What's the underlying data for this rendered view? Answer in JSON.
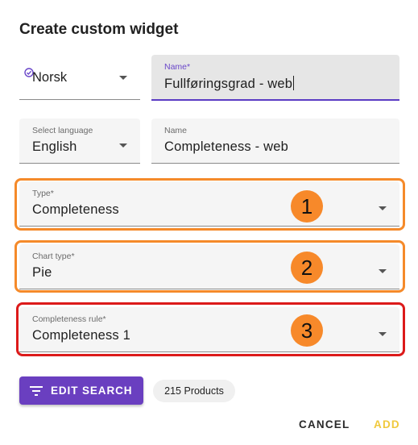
{
  "dialog": {
    "title": "Create custom widget",
    "primary_language": {
      "value": "Norsk"
    },
    "primary_name": {
      "label": "Name",
      "required_mark": "*",
      "value": "Fullføringsgrad - web"
    },
    "language_select": {
      "label": "Select language",
      "value": "English"
    },
    "secondary_name": {
      "label": "Name",
      "value": "Completeness - web"
    },
    "type_select": {
      "label": "Type",
      "required_mark": "*",
      "value": "Completeness"
    },
    "chart_type_select": {
      "label": "Chart type",
      "required_mark": "*",
      "value": "Pie"
    },
    "completeness_rule_select": {
      "label": "Completeness rule",
      "required_mark": "*",
      "value": "Completeness 1"
    },
    "annotations": [
      "1",
      "2",
      "3"
    ],
    "edit_search_button": {
      "label": "EDIT SEARCH",
      "icon": "filter-list-icon"
    },
    "product_count_chip": "215 Products",
    "cancel_button": "CANCEL",
    "add_button": "ADD"
  },
  "colors": {
    "accent": "#6a3fc0",
    "highlight_orange": "#f58a2a",
    "highlight_red": "#dc1a1a",
    "badge_fill": "#f7892a",
    "add_disabled": "#f0c93c"
  }
}
